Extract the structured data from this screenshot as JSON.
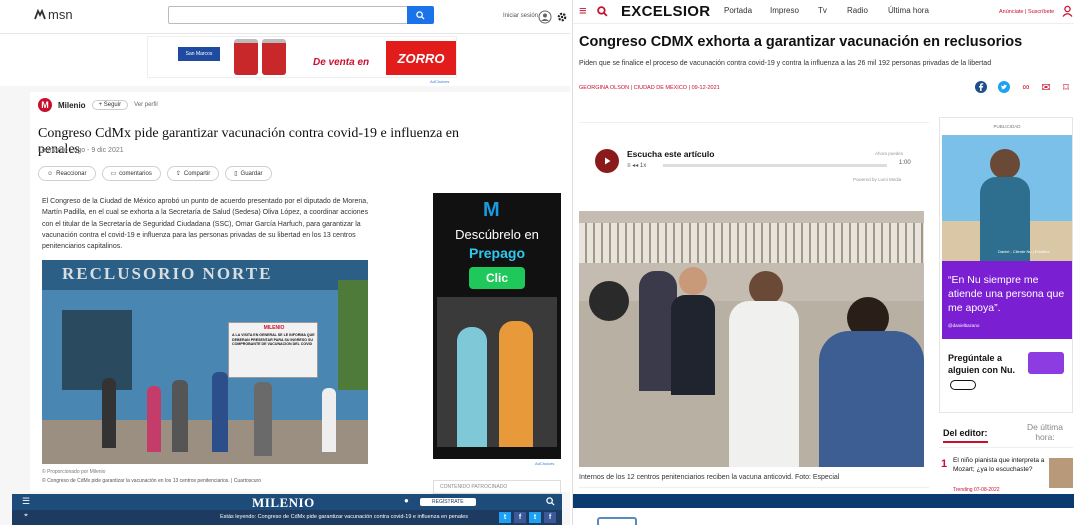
{
  "msn": {
    "logo": "msn",
    "signin": "Iniciar sesión",
    "ad": {
      "brand": "San Marcos",
      "slogan": "De venta en",
      "store": "ZORRO",
      "adchoices": "AdChoices"
    }
  },
  "milenio_article": {
    "source": "Milenio",
    "follow_label": "+ Seguir",
    "profile_label": "Ver perfil",
    "title": "Congreso CdMx pide garantizar vacunación contra covid-19 e influenza en penales",
    "byline": "Leonardo Lugo - 9 dic 2021",
    "actions": [
      "Reaccionar",
      "comentarios",
      "Compartir",
      "Guardar"
    ],
    "body": "El Congreso de la Ciudad de México aprobó un punto de acuerdo presentado por el diputado de Morena, Martín Padilla, en el cual se exhorta a la Secretaría de Salud (Sedesa) Oliva López, a coordinar acciones con el titular de la Secretaría de Seguridad Ciudadana (SSC), Omar García Harfuch, para garantizar la vacunación contra el covid-19 e influenza para las personas privadas de su libertad en los 13 centros penitenciarios capitalinos.",
    "photo_sign": "RECLUSORIO NORTE",
    "photo_banner_brand": "MILENIO",
    "photo_banner_text": "A LA VISITA EN GENERAL SE LE INFORMA QUE DEBERAN PRESENTAR PARA SU INGRESO SU COMPROBANTE DE VACUNACION DEL COVID",
    "caption_credit": "© Proporcionado por Milenio",
    "caption": "© Congreso de CdMx pide garantizar la vacunación en los 13 centros penitenciarios. | Cuartoscuro",
    "side_ad": {
      "brand": "Movistar",
      "line1": "Descúbrelo en",
      "line2": "Prepago",
      "cta": "Clic",
      "adchoices": "AdChoices"
    },
    "sponsored": "CONTENIDO PATROCINADO"
  },
  "milenio_bar": {
    "logo": "MILENIO",
    "register": "REGÍSTRATE",
    "legend": "Estás leyendo: Congreso de CdMx pide garantizar vacunación contra covid-19 e influenza en penales",
    "share": [
      "t",
      "f",
      "t",
      "f"
    ]
  },
  "excelsior": {
    "logo": "EXCELSIOR",
    "nav": [
      "Portada",
      "Impreso",
      "Tv",
      "Radio",
      "Última hora"
    ],
    "anuncia": "Anúnciate | Suscríbete",
    "title": "Congreso CDMX exhorta a garantizar vacunación en reclusorios",
    "subtitle": "Piden que se finalice el proceso de vacunación contra covid-19 y contra la influenza a las 26 mil 192 personas privadas de la libertad",
    "author": "GEORGINA OLSON | CIUDAD DE MÉXICO | 09-12-2021",
    "audio": {
      "title": "Escucha este artículo",
      "speed": "1x",
      "duration": "1:00",
      "ahora": "Ahora puedes",
      "powered": "Powered by Lumi Media",
      "progress": 0.0
    },
    "photo_caption": "Internos de los 12 centros penitenciarios reciben la vacuna anticovid. Foto: Especial",
    "ad": {
      "label": "PUBLICIDAD",
      "credit": "Daniel - Cliente Nu | EdoMex",
      "quote": "“En Nu siempre me atiende una persona que me apoya”.",
      "handle": "@danielbazano",
      "ask": "Pregúntale a alguien con Nu."
    },
    "tabs": [
      "Del editor:",
      "De última hora:"
    ],
    "news": {
      "num": "1",
      "text": "El niño pianista que interpreta a Mozart; ¿ya lo escuchaste?",
      "tag": "Trending 07-08-2022"
    }
  }
}
